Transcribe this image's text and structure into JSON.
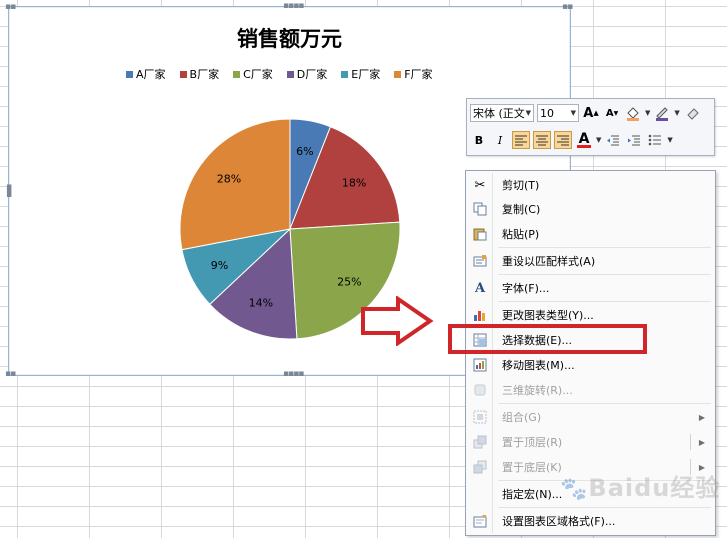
{
  "chart": {
    "title": "销售额万元",
    "chart_data": {
      "type": "pie",
      "title": "销售额万元",
      "categories": [
        "A厂家",
        "B厂家",
        "C厂家",
        "D厂家",
        "E厂家",
        "F厂家"
      ],
      "values": [
        6,
        18,
        25,
        14,
        9,
        28
      ],
      "value_labels": [
        "6%",
        "18%",
        "25%",
        "14%",
        "9%",
        "28%"
      ],
      "colors": [
        "#4a7ab5",
        "#b0413e",
        "#8ba64a",
        "#71588f",
        "#4299b1",
        "#dd8637"
      ],
      "legend": "top"
    }
  },
  "toolbar": {
    "font_name": "宋体 (正文",
    "font_size": "10",
    "grow_font": "A",
    "shrink_font": "A",
    "bold": "B",
    "italic": "I",
    "font_color": "A"
  },
  "context_menu": {
    "items": [
      {
        "label": "剪切(T)",
        "icon": "scissors-icon",
        "enabled": true
      },
      {
        "label": "复制(C)",
        "icon": "copy-icon",
        "enabled": true
      },
      {
        "label": "粘贴(P)",
        "icon": "paste-icon",
        "enabled": true
      },
      {
        "label": "重设以匹配样式(A)",
        "icon": "reset-style-icon",
        "enabled": true
      },
      {
        "label": "字体(F)...",
        "icon": "font-icon",
        "enabled": true
      },
      {
        "label": "更改图表类型(Y)...",
        "icon": "chart-type-icon",
        "enabled": true
      },
      {
        "label": "选择数据(E)...",
        "icon": "select-data-icon",
        "enabled": true
      },
      {
        "label": "移动图表(M)...",
        "icon": "move-chart-icon",
        "enabled": true
      },
      {
        "label": "三维旋转(R)...",
        "icon": "3d-rotation-icon",
        "enabled": false
      },
      {
        "label": "组合(G)",
        "icon": "group-icon",
        "enabled": false
      },
      {
        "label": "置于顶层(R)",
        "icon": "bring-front-icon",
        "enabled": false
      },
      {
        "label": "置于底层(K)",
        "icon": "send-back-icon",
        "enabled": false
      },
      {
        "label": "指定宏(N)...",
        "icon": "macro-icon",
        "enabled": true
      },
      {
        "label": "设置图表区域格式(F)...",
        "icon": "format-chart-area-icon",
        "enabled": true
      }
    ]
  },
  "watermark": {
    "text": "Baidu经验"
  }
}
